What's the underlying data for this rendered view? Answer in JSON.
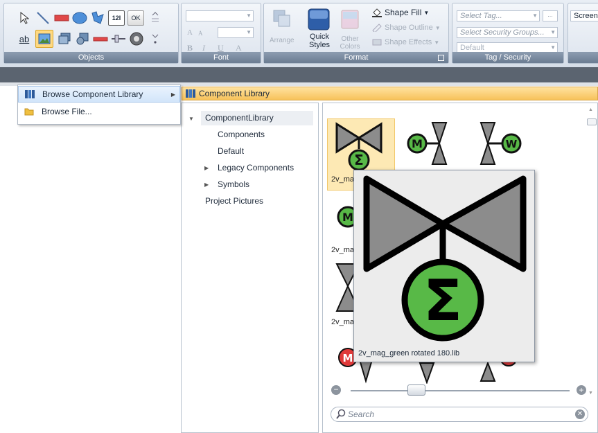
{
  "ribbon": {
    "groups": {
      "objects": "Objects",
      "font": "Font",
      "format": "Format",
      "tag_security": "Tag / Security"
    },
    "text_tool": "ab",
    "numeric_tool": "12I",
    "ok_tool": "OK",
    "font_buttons": [
      "A",
      "A",
      "B",
      "I",
      "U",
      "A"
    ],
    "arrange": "Arrange",
    "quick_styles": "Quick\nStyles",
    "quick_styles_line1": "Quick",
    "quick_styles_line2": "Styles",
    "other_colors_line1": "Other",
    "other_colors_line2": "Colors",
    "shape_fill": "Shape Fill",
    "shape_outline": "Shape Outline",
    "shape_effects": "Shape Effects",
    "select_tag": "Select Tag...",
    "select_security": "Select Security Groups...",
    "default_value": "Default",
    "screen_tab": "Screen"
  },
  "menu": {
    "items": [
      {
        "label": "Browse Component Library"
      },
      {
        "label": "Browse File..."
      }
    ]
  },
  "library": {
    "title": "Component Library",
    "tree": {
      "root": "ComponentLibrary",
      "children": [
        "Components",
        "Default",
        "Legacy Components",
        "Symbols"
      ],
      "project_pictures": "Project Pictures"
    },
    "thumb_labels": [
      "2v_ma",
      "2v_ma",
      "2v_ma"
    ],
    "tooltip_caption": "2v_mag_green rotated 180.lib",
    "slider_value": 0.3,
    "search_placeholder": "Search"
  },
  "colors": {
    "accent_orange": "#f7c25a",
    "valve_green": "#58b947",
    "valve_gray": "#8c8c8c",
    "dark_bar": "#5b6470",
    "alarm_red": "#e03a3a"
  }
}
